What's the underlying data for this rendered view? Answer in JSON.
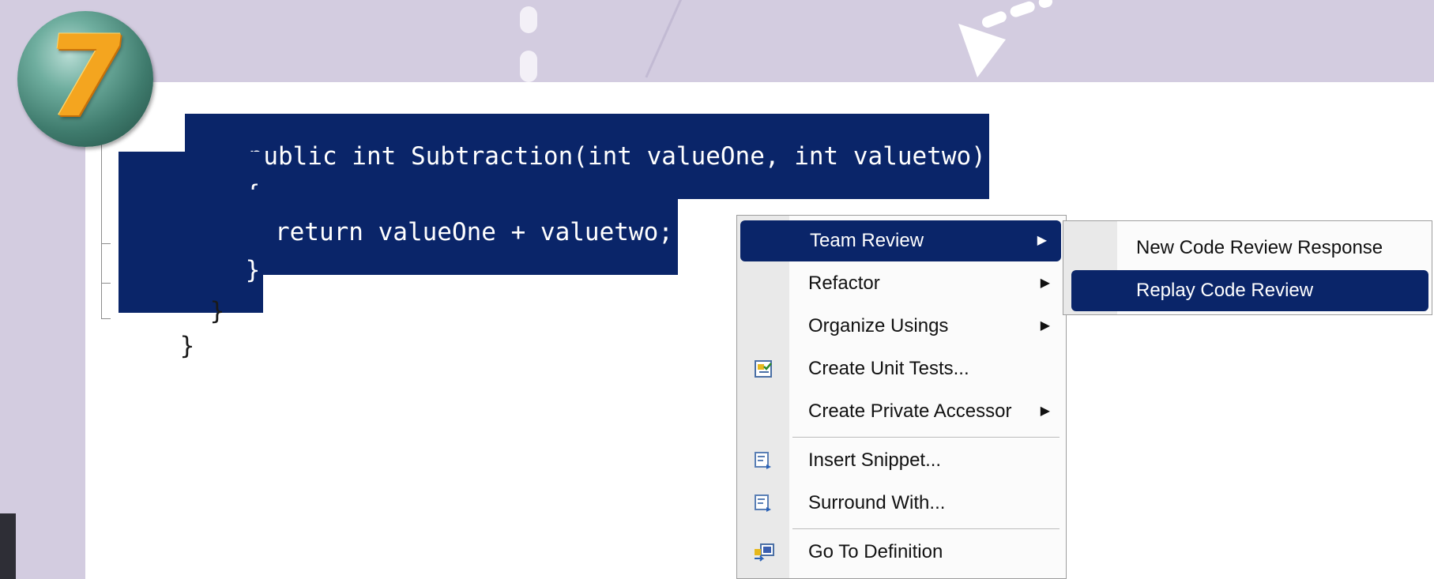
{
  "step": {
    "number": "7"
  },
  "code": {
    "lines": [
      "public int Subtraction(int valueOne, int valuetwo)",
      "{",
      "  return valueOne + valuetwo;",
      "}",
      "}",
      "}"
    ]
  },
  "context_menu": {
    "items": [
      {
        "label": "Team Review",
        "icon": "",
        "submenu": true,
        "highlighted": true
      },
      {
        "label": "Refactor",
        "icon": "",
        "submenu": true
      },
      {
        "label": "Organize Usings",
        "icon": "",
        "submenu": true
      },
      {
        "label": "Create Unit Tests...",
        "icon": "unit-test-icon",
        "submenu": false
      },
      {
        "label": "Create Private Accessor",
        "icon": "",
        "submenu": true
      },
      {
        "label": "Insert Snippet...",
        "icon": "insert-snippet-icon",
        "submenu": false
      },
      {
        "label": "Surround With...",
        "icon": "surround-with-icon",
        "submenu": false
      },
      {
        "label": "Go To Definition",
        "icon": "go-to-definition-icon",
        "submenu": false
      }
    ],
    "submenu_arrow": "▶"
  },
  "submenu": {
    "items": [
      {
        "label": "New Code Review Response",
        "highlighted": false
      },
      {
        "label": "Replay Code Review",
        "highlighted": true
      }
    ]
  },
  "colors": {
    "selection": "#0a2569",
    "banner": "#d3cce0",
    "badge_number": "#f4a51f",
    "badge_ball": "#3f7b6d"
  }
}
